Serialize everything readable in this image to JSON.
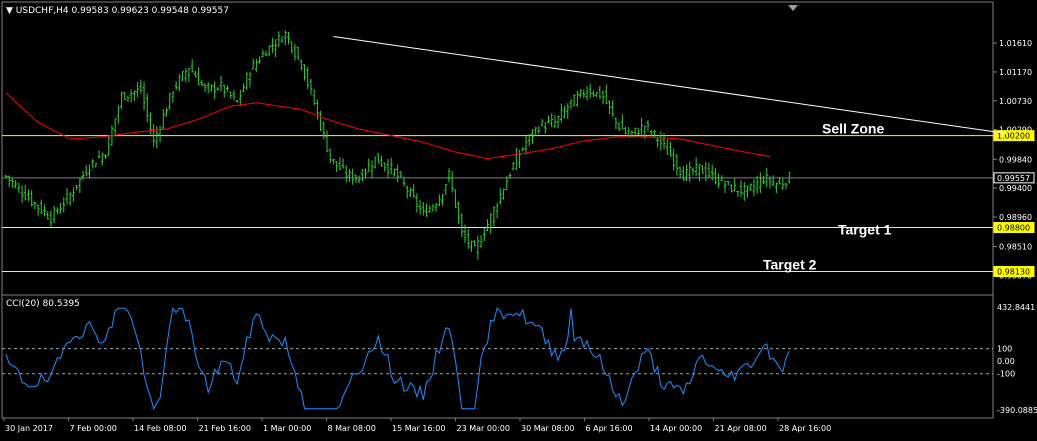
{
  "header": {
    "symbol_label": "USDCHF,H4",
    "ohlc_values": "0.99583 0.99623 0.99548 0.99557",
    "menu_arrow_icon": "triangle-down-icon"
  },
  "colors": {
    "background": "#000000",
    "candles": "#32cd32",
    "moving_average": "#ff0000",
    "cci_line": "#1e90ff",
    "level_lines": "#ffff00",
    "trendline": "#ffffff",
    "current_price_line": "#708090",
    "grid_text": "#ffffff"
  },
  "cci_panel": {
    "label": "CCI(20) 80.5395",
    "max_label": "432.8441",
    "min_label": "-390.0885"
  },
  "annotations": [
    {
      "key": "sell",
      "text": "Sell Zone"
    },
    {
      "key": "t1",
      "text": "Target 1"
    },
    {
      "key": "t2",
      "text": "Target 2"
    }
  ],
  "chart_data": [
    {
      "type": "candlestick",
      "title": "USDCHF,H4",
      "price_axis_ticks": [
        "1.01610",
        "1.01170",
        "1.00730",
        "1.00290",
        "0.99840",
        "0.99400",
        "0.98960",
        "0.98510",
        "0.98070"
      ],
      "price_range": [
        0.9797,
        1.0184
      ],
      "highlighted_levels": [
        {
          "label": "1.00200",
          "value": 1.002,
          "color": "#ffff00"
        },
        {
          "label": "0.99557",
          "value": 0.99557,
          "color": "#708090"
        },
        {
          "label": "0.98800",
          "value": 0.988,
          "color": "#ffff00"
        },
        {
          "label": "0.98130",
          "value": 0.9813,
          "color": "#ffff00"
        }
      ],
      "x_tick_labels": [
        "30 Jan 2017",
        "7 Feb 00:00",
        "14 Feb 08:00",
        "21 Feb 16:00",
        "1 Mar 00:00",
        "8 Mar 08:00",
        "15 Mar 16:00",
        "23 Mar 00:00",
        "30 Mar 08:00",
        "6 Apr 16:00",
        "14 Apr 00:00",
        "21 Apr 08:00",
        "28 Apr 16:00"
      ],
      "close_path": [
        [
          0,
          0.9958
        ],
        [
          8,
          0.992
        ],
        [
          14,
          0.9895
        ],
        [
          20,
          0.993
        ],
        [
          26,
          0.9975
        ],
        [
          31,
          0.9995
        ],
        [
          36,
          1.008
        ],
        [
          42,
          1.009
        ],
        [
          46,
          1.001
        ],
        [
          52,
          1.009
        ],
        [
          57,
          1.0125
        ],
        [
          62,
          1.009
        ],
        [
          67,
          1.0095
        ],
        [
          72,
          1.007
        ],
        [
          76,
          1.012
        ],
        [
          81,
          1.015
        ],
        [
          87,
          1.0175
        ],
        [
          92,
          1.013
        ],
        [
          96,
          1.007
        ],
        [
          101,
          0.9985
        ],
        [
          106,
          0.996
        ],
        [
          110,
          0.9955
        ],
        [
          115,
          0.9985
        ],
        [
          121,
          0.9965
        ],
        [
          126,
          0.993
        ],
        [
          130,
          0.99
        ],
        [
          135,
          0.9925
        ],
        [
          138,
          0.996
        ],
        [
          142,
          0.987
        ],
        [
          146,
          0.9845
        ],
        [
          150,
          0.9885
        ],
        [
          154,
          0.993
        ],
        [
          158,
          0.9975
        ],
        [
          162,
          1.001
        ],
        [
          166,
          1.0035
        ],
        [
          171,
          1.004
        ],
        [
          176,
          1.007
        ],
        [
          181,
          1.009
        ],
        [
          186,
          1.008
        ],
        [
          190,
          1.004
        ],
        [
          194,
          1.002
        ],
        [
          199,
          1.0035
        ],
        [
          203,
          1.0015
        ],
        [
          207,
          0.999
        ],
        [
          211,
          0.996
        ],
        [
          216,
          0.997
        ],
        [
          221,
          0.9955
        ],
        [
          226,
          0.994
        ],
        [
          231,
          0.9935
        ],
        [
          236,
          0.9955
        ],
        [
          241,
          0.9945
        ],
        [
          244,
          0.9956
        ]
      ],
      "moving_average": [
        [
          0,
          1.0085
        ],
        [
          10,
          1.004
        ],
        [
          20,
          1.0015
        ],
        [
          30,
          1.0018
        ],
        [
          40,
          1.0025
        ],
        [
          50,
          1.003
        ],
        [
          60,
          1.0045
        ],
        [
          70,
          1.0065
        ],
        [
          78,
          1.007
        ],
        [
          85,
          1.0065
        ],
        [
          92,
          1.006
        ],
        [
          100,
          1.0045
        ],
        [
          110,
          1.003
        ],
        [
          120,
          1.002
        ],
        [
          130,
          1.001
        ],
        [
          140,
          0.9995
        ],
        [
          150,
          0.9985
        ],
        [
          160,
          0.9992
        ],
        [
          170,
          1.0
        ],
        [
          180,
          1.0012
        ],
        [
          190,
          1.0018
        ],
        [
          200,
          1.0018
        ],
        [
          210,
          1.0015
        ],
        [
          220,
          1.0005
        ],
        [
          230,
          0.9995
        ],
        [
          238,
          0.9988
        ]
      ],
      "trendline": {
        "start": [
          102,
          1.0171
        ],
        "end": [
          312,
          1.0023
        ]
      },
      "series": [
        {
          "name": "USDCHF,H4"
        }
      ]
    },
    {
      "type": "line",
      "title": "CCI(20) 80.5395",
      "ylim": [
        -390.0885,
        432.8441
      ],
      "y_tick_labels": [
        "432.8441",
        "100",
        "0.00",
        "-100",
        "-390.0885"
      ],
      "reference_levels": [
        100,
        -100
      ],
      "last_value": 80.5395,
      "series": [
        {
          "name": "CCI(20)"
        }
      ]
    }
  ]
}
